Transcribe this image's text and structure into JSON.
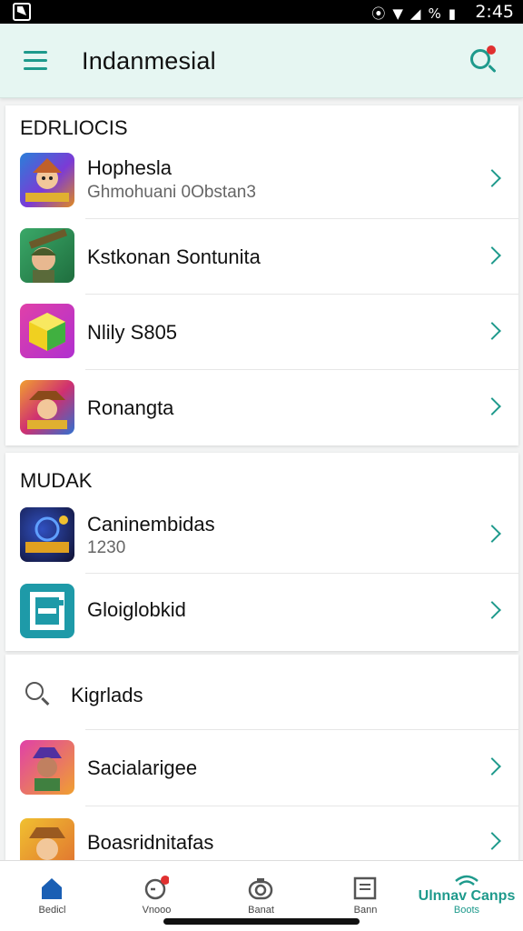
{
  "status_bar": {
    "time": "2:45",
    "icons": [
      "notification-icon",
      "wifi-icon",
      "signal-icon",
      "battery-icon"
    ],
    "battery_text": "%"
  },
  "app_bar": {
    "title": "Indanmesial"
  },
  "section1": {
    "title": "EDRLIOCIS",
    "items": [
      {
        "title": "Hophesla",
        "subtitle": "Ghmohuani 0Obstan3"
      },
      {
        "title": "Kstkonan Sontunita"
      },
      {
        "title": "Nlily S805"
      },
      {
        "title": "Ronangta"
      }
    ]
  },
  "section2": {
    "title": "MUDAK",
    "items": [
      {
        "title": "Caninembidas",
        "subtitle": "1230"
      },
      {
        "title": "Gloiglobkid"
      }
    ]
  },
  "section3": {
    "search_label": "Kigrlads",
    "items": [
      {
        "title": "Sacialarigee"
      },
      {
        "title": "Boasridnitafas"
      }
    ]
  },
  "bottom_nav": {
    "items": [
      {
        "label": "Bedicl"
      },
      {
        "label": "Vnooo"
      },
      {
        "label": "Banat"
      },
      {
        "label": "Bann"
      },
      {
        "label": "Ulnnav Canps",
        "sub": "Boots"
      }
    ]
  },
  "colors": {
    "accent": "#1e9a8c",
    "app_bar_bg": "#e6f6f2",
    "badge": "#e03030",
    "nav_active": "#1a5fb4"
  }
}
